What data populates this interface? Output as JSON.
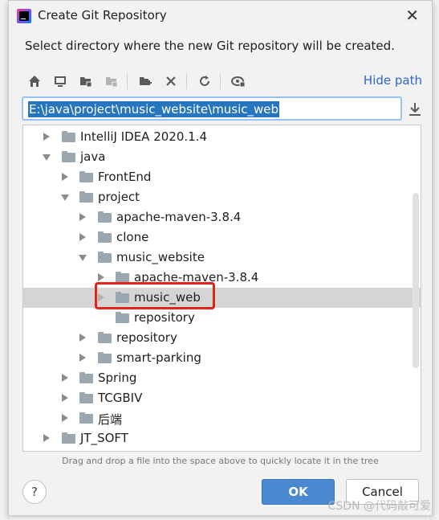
{
  "dialog": {
    "title": "Create Git Repository",
    "subtitle": "Select directory where the new Git repository will be created.",
    "hide_path_label": "Hide path",
    "path_value": "E:\\java\\project\\music_website\\music_web",
    "hint": "Drag and drop a file into the space above to quickly locate it in the tree",
    "help_label": "?",
    "ok_label": "OK",
    "cancel_label": "Cancel"
  },
  "toolbar": {
    "icons": [
      "home-icon",
      "desktop-icon",
      "project-folder-icon",
      "module-folder-icon",
      "new-folder-icon",
      "delete-icon",
      "refresh-icon",
      "show-hidden-icon"
    ]
  },
  "tree": {
    "rows": [
      {
        "label": "IntelliJ IDEA 2020.1.4",
        "expanded": false
      },
      {
        "label": "java",
        "expanded": true
      },
      {
        "label": "FrontEnd",
        "expanded": false
      },
      {
        "label": "project",
        "expanded": true
      },
      {
        "label": "apache-maven-3.8.4",
        "expanded": false
      },
      {
        "label": "clone",
        "expanded": false
      },
      {
        "label": "music_website",
        "expanded": true
      },
      {
        "label": "apache-maven-3.8.4",
        "expanded": false
      },
      {
        "label": "music_web",
        "expanded": false,
        "selected": true
      },
      {
        "label": "repository",
        "expanded": false
      },
      {
        "label": "repository",
        "expanded": false
      },
      {
        "label": "smart-parking",
        "expanded": false
      },
      {
        "label": "Spring",
        "expanded": false
      },
      {
        "label": "TCGBIV",
        "expanded": false
      },
      {
        "label": "后端",
        "expanded": false
      },
      {
        "label": "JT_SOFT",
        "expanded": false
      }
    ]
  },
  "watermark": "CSDN @代码敲可爱",
  "colors": {
    "accent": "#4a88cf",
    "selection": "#2675bf",
    "highlight": "#e2231a",
    "link": "#2f65ca"
  }
}
